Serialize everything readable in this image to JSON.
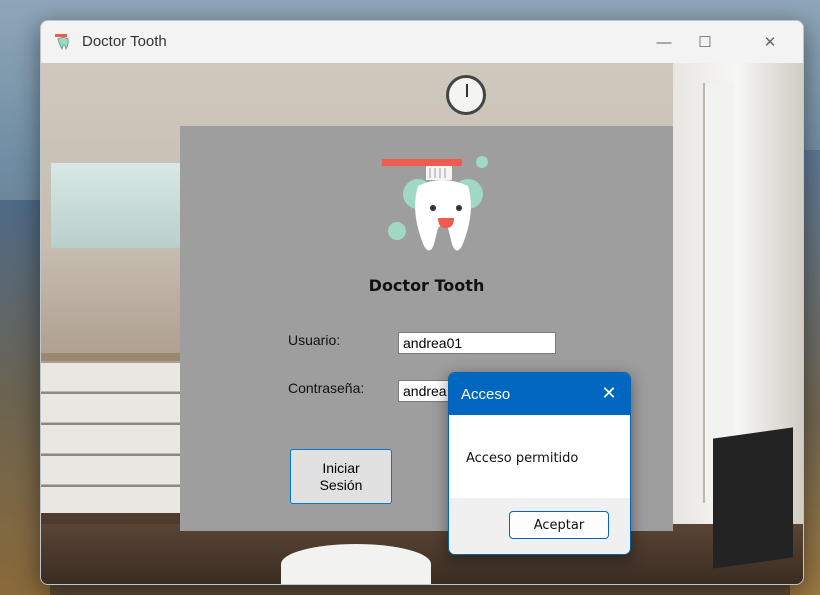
{
  "window": {
    "title": "Doctor Tooth",
    "icon": "tooth-app-icon",
    "controls": {
      "minimize": "—",
      "maximize": "☐",
      "close": "✕"
    }
  },
  "login": {
    "brand": "Doctor Tooth",
    "username_label": "Usuario:",
    "username_value": "andrea01",
    "password_label": "Contraseña:",
    "password_value": "andrea",
    "login_button": "Iniciar\nSesión"
  },
  "dialog": {
    "title": "Acceso",
    "close": "✕",
    "message": "Acceso permitido",
    "ok_button": "Aceptar",
    "accent_color": "#0067c0"
  },
  "colors": {
    "panel": "#9e9e9e",
    "toothbrush": "#ef5b4f",
    "bubble": "#9fd8c3"
  }
}
